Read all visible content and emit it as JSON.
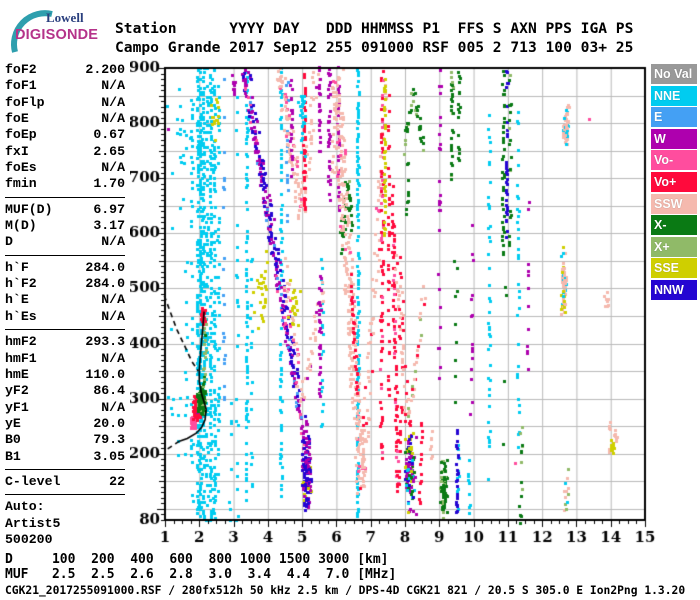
{
  "logo": {
    "top": "Lowell",
    "bottom": "DIGISONDE",
    "arc_color": "#2E9FAE"
  },
  "header": {
    "line1": "Station      YYYY DAY   DDD HHMMSS P1  FFS S AXN PPS IGA PS",
    "line2": "Campo Grande 2017 Sep12 255 091000 RSF 005 2 713 100 03+ 25"
  },
  "params": {
    "groups": [
      [
        [
          "foF2",
          "2.200"
        ],
        [
          "foF1",
          "N/A"
        ],
        [
          "foFlp",
          "N/A"
        ],
        [
          "foE",
          "N/A"
        ],
        [
          "foEp",
          "0.67"
        ],
        [
          "fxI",
          "2.65"
        ],
        [
          "foEs",
          "N/A"
        ],
        [
          "fmin",
          "1.70"
        ]
      ],
      [
        [
          "MUF(D)",
          "6.97"
        ],
        [
          "M(D)",
          "3.17"
        ],
        [
          "D",
          "N/A"
        ]
      ],
      [
        [
          "h`F",
          "284.0"
        ],
        [
          "h`F2",
          "284.0"
        ],
        [
          "h`E",
          "N/A"
        ],
        [
          "h`Es",
          "N/A"
        ]
      ],
      [
        [
          "hmF2",
          "293.3"
        ],
        [
          "hmF1",
          "N/A"
        ],
        [
          "hmE",
          "110.0"
        ],
        [
          "yF2",
          "86.4"
        ],
        [
          "yF1",
          "N/A"
        ],
        [
          "yE",
          "20.0"
        ],
        [
          "B0",
          "79.3"
        ],
        [
          "B1",
          "3.05"
        ]
      ],
      [
        [
          "C-level",
          "22"
        ]
      ]
    ],
    "auto_lines": [
      "Auto:",
      "Artist5",
      "500200"
    ]
  },
  "dmuf": {
    "d_label": "D",
    "d_values": [
      "100",
      "200",
      "400",
      "600",
      "800",
      "1000",
      "1500",
      "3000"
    ],
    "d_unit": "[km]",
    "muf_label": "MUF",
    "muf_values": [
      "2.5",
      "2.5",
      "2.6",
      "2.8",
      "3.0",
      "3.4",
      "4.4",
      "7.0"
    ],
    "muf_unit": "[MHz]"
  },
  "footer": {
    "text": "CGK21_2017255091000.RSF / 280fx512h 50 kHz 2.5 km / DPS-4D CGK21 821 / 20.5 S 305.0 E Ion2Png 1.3.20"
  },
  "chart_data": {
    "type": "scatter",
    "x_axis": {
      "label_unit": "MHz",
      "min": 1,
      "max": 15,
      "tick_labels": [
        "1",
        "2",
        "3",
        "4",
        "5",
        "6",
        "7",
        "8",
        "9",
        "10",
        "11",
        "12",
        "13",
        "14",
        "15"
      ],
      "minor_step": 0.25
    },
    "y_axis": {
      "label_unit": "km",
      "min": 80,
      "max": 900,
      "tick_labels": [
        "900",
        "800",
        "700",
        "600",
        "500",
        "400",
        "300",
        "200"
      ],
      "bottom_label": "80",
      "grid_step": 50,
      "minor_step": 10
    },
    "grid": {
      "color": "#b9b9b9",
      "frame_color": "#000000"
    },
    "legend": [
      {
        "label": "No Val",
        "color": "#999999"
      },
      {
        "label": "NNE",
        "color": "#00CCF0"
      },
      {
        "label": "E",
        "color": "#44A0F4"
      },
      {
        "label": "W",
        "color": "#AE00AE"
      },
      {
        "label": "Vo-",
        "color": "#FF4D9E"
      },
      {
        "label": "Vo+",
        "color": "#FF0A3C"
      },
      {
        "label": "SSW",
        "color": "#F5B9AE"
      },
      {
        "label": "X-",
        "color": "#0A7A14"
      },
      {
        "label": "X+",
        "color": "#90BA68"
      },
      {
        "label": "SSE",
        "color": "#CFCF00"
      },
      {
        "label": "NNW",
        "color": "#2405D2"
      }
    ],
    "profile_curve": {
      "solid": [
        [
          2.14,
          458
        ],
        [
          2.09,
          420
        ],
        [
          2.04,
          385
        ],
        [
          2.0,
          352
        ],
        [
          2.0,
          332
        ],
        [
          2.06,
          310
        ],
        [
          2.13,
          296
        ],
        [
          2.2,
          282
        ],
        [
          2.17,
          262
        ],
        [
          2.07,
          248
        ],
        [
          1.9,
          237
        ],
        [
          1.65,
          228
        ],
        [
          1.42,
          223
        ]
      ],
      "dashed": [
        [
          [
            0.98,
            487
          ],
          [
            1.15,
            458
          ],
          [
            1.35,
            425
          ],
          [
            1.58,
            395
          ],
          [
            1.78,
            368
          ],
          [
            1.97,
            350
          ]
        ],
        [
          [
            1.42,
            223
          ],
          [
            1.2,
            214
          ],
          [
            1.0,
            206
          ]
        ]
      ]
    },
    "feature_format": "v=[v,f,h0,h1,density,color] vertical RFI line; b=[b,f0,h0,f1,h1,widthMHz,density,color] echo band; o=[o,f,h,rf,rh,n,color] cluster blob; f in MHz, h in km",
    "features": [
      [
        "v",
        1.62,
        200,
        560,
        0.15,
        "NNE"
      ],
      [
        "v",
        1.78,
        90,
        870,
        0.2,
        "NNE"
      ],
      [
        "v",
        1.95,
        80,
        900,
        0.5,
        "NNE"
      ],
      [
        "v",
        2.03,
        80,
        900,
        0.65,
        "NNE"
      ],
      [
        "v",
        2.12,
        80,
        900,
        0.5,
        "NNE"
      ],
      [
        "v",
        2.22,
        80,
        900,
        0.3,
        "NNE"
      ],
      [
        "v",
        2.33,
        80,
        900,
        0.45,
        "NNE"
      ],
      [
        "v",
        2.44,
        80,
        900,
        0.4,
        "NNE"
      ],
      [
        "v",
        2.56,
        120,
        880,
        0.2,
        "NNE"
      ],
      [
        "v",
        2.72,
        300,
        880,
        0.13,
        "E"
      ],
      [
        "v",
        2.9,
        80,
        320,
        0.2,
        "NNE"
      ],
      [
        "v",
        3.1,
        80,
        860,
        0.15,
        "NNE"
      ],
      [
        "v",
        3.38,
        80,
        900,
        0.4,
        "NNE"
      ],
      [
        "v",
        3.52,
        90,
        600,
        0.13,
        "NNE"
      ],
      [
        "v",
        4.38,
        120,
        900,
        0.32,
        "NNE"
      ],
      [
        "v",
        4.56,
        550,
        900,
        0.18,
        "E"
      ],
      [
        "v",
        5.57,
        250,
        570,
        0.22,
        "NNE"
      ],
      [
        "v",
        6.62,
        80,
        900,
        0.5,
        "NNE"
      ],
      [
        "v",
        9.55,
        100,
        250,
        0.35,
        "NNE"
      ],
      [
        "v",
        9.87,
        80,
        200,
        0.28,
        "NNE"
      ],
      [
        "v",
        10.45,
        130,
        850,
        0.22,
        "NNE"
      ],
      [
        "v",
        11.3,
        200,
        830,
        0.22,
        "NNE"
      ],
      [
        "b",
        3.28,
        900,
        5.12,
        195,
        0.13,
        0.7,
        {
          "W": 0.5,
          "NNW": 0.3,
          "Vo-": 0.1,
          "E": 0.1
        }
      ],
      [
        "b",
        3.42,
        900,
        5.22,
        210,
        0.05,
        0.3,
        {
          "NNW": 0.7,
          "W": 0.3
        }
      ],
      [
        "b",
        4.34,
        900,
        4.97,
        635,
        0.26,
        0.7,
        {
          "SSW": 0.85,
          "Vo-": 0.15
        }
      ],
      [
        "b",
        4.97,
        635,
        5.42,
        900,
        0.2,
        0.5,
        {
          "SSW": 0.9,
          "W": 0.1
        }
      ],
      [
        "b",
        4.68,
        700,
        4.68,
        900,
        0.06,
        0.5,
        "W"
      ],
      [
        "b",
        5.06,
        640,
        5.06,
        900,
        0.05,
        0.55,
        "Vo+"
      ],
      [
        "b",
        5.5,
        740,
        5.5,
        900,
        0.05,
        0.5,
        "W"
      ],
      [
        "o",
        5.0,
        810,
        0.12,
        70,
        25,
        "NNE"
      ],
      [
        "b",
        4.42,
        560,
        5.0,
        288,
        0.22,
        0.55,
        {
          "SSW": 0.8,
          "Vo-": 0.2
        }
      ],
      [
        "b",
        5.0,
        288,
        5.62,
        520,
        0.18,
        0.5,
        {
          "SSW": 0.85,
          "W": 0.15
        }
      ],
      [
        "b",
        5.5,
        300,
        5.52,
        530,
        0.06,
        0.5,
        "W"
      ],
      [
        "o",
        5.12,
        165,
        0.17,
        75,
        110,
        {
          "W": 0.45,
          "NNW": 0.45,
          "SSE": 0.1
        }
      ],
      [
        "o",
        3.8,
        490,
        0.25,
        80,
        26,
        "SSE"
      ],
      [
        "o",
        4.75,
        470,
        0.2,
        70,
        20,
        "SSE"
      ],
      [
        "o",
        2.45,
        820,
        0.15,
        55,
        14,
        "SSE"
      ],
      [
        "o",
        3.0,
        870,
        0.08,
        25,
        10,
        "W"
      ],
      [
        "b",
        5.78,
        660,
        5.78,
        900,
        0.08,
        0.5,
        "W"
      ],
      [
        "b",
        6.06,
        640,
        6.06,
        900,
        0.06,
        0.45,
        {
          "W": 0.7,
          "SSW": 0.3
        }
      ],
      [
        "b",
        5.9,
        700,
        6.12,
        900,
        0.18,
        0.45,
        "SSW"
      ],
      [
        "b",
        6.1,
        560,
        6.35,
        700,
        0.2,
        0.4,
        {
          "X-": 0.8,
          "X+": 0.2
        }
      ],
      [
        "b",
        6.18,
        600,
        6.32,
        695,
        0.07,
        0.5,
        "X-"
      ],
      [
        "b",
        6.32,
        695,
        6.48,
        590,
        0.07,
        0.45,
        "X-"
      ],
      [
        "b",
        5.98,
        880,
        6.73,
        135,
        0.28,
        0.75,
        {
          "SSW": 0.92,
          "Vo-": 0.08
        }
      ],
      [
        "b",
        6.73,
        135,
        7.2,
        620,
        0.2,
        0.5,
        {
          "SSW": 0.85,
          "Vo+": 0.15
        }
      ],
      [
        "b",
        7.2,
        620,
        7.42,
        880,
        0.15,
        0.4,
        {
          "SSW": 0.8,
          "Vo-": 0.2
        }
      ],
      [
        "b",
        6.35,
        560,
        6.62,
        300,
        0.07,
        0.45,
        "Vo+"
      ],
      [
        "b",
        7.62,
        680,
        7.78,
        135,
        0.08,
        0.55,
        {
          "Vo+": 0.8,
          "Vo-": 0.2
        }
      ],
      [
        "b",
        7.78,
        135,
        7.92,
        300,
        0.06,
        0.4,
        "Vo+"
      ],
      [
        "b",
        7.3,
        200,
        7.34,
        900,
        0.07,
        0.5,
        {
          "Vo+": 0.75,
          "Vo-": 0.25
        }
      ],
      [
        "b",
        7.4,
        600,
        7.4,
        880,
        0.05,
        0.5,
        "SSE"
      ],
      [
        "b",
        7.52,
        300,
        7.52,
        870,
        0.05,
        0.22,
        "Vo+"
      ],
      [
        "b",
        7.75,
        560,
        8.1,
        245,
        0.18,
        0.5,
        {
          "SSW": 0.6,
          "Vo+": 0.4
        }
      ],
      [
        "b",
        8.1,
        245,
        8.6,
        520,
        0.15,
        0.42,
        {
          "SSW": 0.55,
          "Vo+": 0.3,
          "X+": 0.15
        }
      ],
      [
        "b",
        7.95,
        750,
        8.25,
        862,
        0.1,
        0.5,
        {
          "X-": 0.8,
          "X+": 0.2
        }
      ],
      [
        "b",
        8.25,
        862,
        8.55,
        748,
        0.1,
        0.42,
        {
          "X-": 0.8,
          "X+": 0.2
        }
      ],
      [
        "b",
        8.05,
        620,
        8.08,
        740,
        0.08,
        0.35,
        "X-"
      ],
      [
        "o",
        8.15,
        170,
        0.18,
        85,
        120,
        {
          "W": 0.3,
          "SSE": 0.25,
          "NNW": 0.2,
          "X-": 0.15,
          "NNE": 0.1
        }
      ],
      [
        "b",
        8.44,
        100,
        8.47,
        262,
        0.06,
        0.5,
        "Vo+"
      ],
      [
        "b",
        8.75,
        180,
        8.78,
        262,
        0.06,
        0.3,
        "SSW"
      ],
      [
        "b",
        9.0,
        580,
        9.02,
        900,
        0.06,
        0.2,
        "W"
      ],
      [
        "b",
        9.0,
        300,
        9.0,
        560,
        0.05,
        0.1,
        "W"
      ],
      [
        "b",
        9.35,
        700,
        9.37,
        900,
        0.07,
        0.5,
        {
          "X-": 0.8,
          "X+": 0.2
        }
      ],
      [
        "b",
        9.56,
        730,
        9.58,
        900,
        0.06,
        0.4,
        "X-"
      ],
      [
        "b",
        9.45,
        300,
        9.5,
        650,
        0.1,
        0.07,
        "X-"
      ],
      [
        "o",
        9.12,
        135,
        0.13,
        60,
        70,
        {
          "X-": 0.7,
          "X+": 0.3
        }
      ],
      [
        "b",
        9.5,
        90,
        9.52,
        250,
        0.05,
        0.45,
        "NNW"
      ],
      [
        "b",
        9.93,
        260,
        9.96,
        620,
        0.06,
        0.15,
        "W"
      ],
      [
        "b",
        10.85,
        560,
        10.87,
        900,
        0.06,
        0.5,
        "X-"
      ],
      [
        "b",
        10.95,
        600,
        10.97,
        900,
        0.05,
        0.5,
        "NNW"
      ],
      [
        "b",
        11.05,
        560,
        11.07,
        900,
        0.06,
        0.32,
        {
          "X-": 0.7,
          "X+": 0.3
        }
      ],
      [
        "b",
        10.8,
        200,
        10.9,
        540,
        0.12,
        0.06,
        "X-"
      ],
      [
        "b",
        11.36,
        80,
        11.4,
        260,
        0.09,
        0.28,
        {
          "X-": 0.75,
          "X+": 0.25
        }
      ],
      [
        "b",
        11.57,
        300,
        11.6,
        680,
        0.05,
        0.13,
        "W"
      ],
      [
        "o",
        12.7,
        795,
        0.12,
        40,
        55,
        {
          "SSW": 0.8,
          "NNE": 0.2
        }
      ],
      [
        "o",
        12.62,
        510,
        0.1,
        80,
        60,
        {
          "SSW": 0.55,
          "SSE": 0.25,
          "NNE": 0.2
        }
      ],
      [
        "o",
        12.7,
        140,
        0.15,
        60,
        12,
        {
          "SSW": 0.5,
          "X+": 0.3,
          "NNE": 0.2
        }
      ],
      [
        "b",
        13.95,
        205,
        13.98,
        258,
        0.05,
        0.55,
        "SSW"
      ],
      [
        "o",
        14.05,
        215,
        0.08,
        18,
        12,
        "SSE"
      ],
      [
        "o",
        14.15,
        235,
        0.06,
        20,
        8,
        "SSW"
      ],
      [
        "o",
        13.88,
        480,
        0.08,
        25,
        8,
        "SSW"
      ],
      [
        "o",
        11.2,
        185,
        0.01,
        3,
        1,
        "Vo-"
      ],
      [
        "o",
        13.35,
        808,
        0.01,
        3,
        1,
        "Vo-"
      ],
      [
        "o",
        1.08,
        790,
        0.01,
        3,
        1,
        "W"
      ],
      [
        "o",
        1.82,
        258,
        0.09,
        14,
        40,
        "Vo-"
      ],
      [
        "o",
        1.92,
        283,
        0.13,
        24,
        110,
        {
          "Vo+": 0.95,
          "W": 0.05
        }
      ],
      [
        "o",
        2.06,
        295,
        0.13,
        28,
        120,
        {
          "X-": 0.85,
          "X+": 0.15
        }
      ],
      [
        "b",
        2.14,
        322,
        2.18,
        462,
        0.08,
        0.42,
        {
          "X+": 0.8,
          "X-": 0.2
        }
      ],
      [
        "o",
        2.1,
        450,
        0.07,
        16,
        28,
        "Vo+"
      ],
      [
        "o",
        1.45,
        740,
        0.45,
        160,
        22,
        "NNE"
      ],
      [
        "o",
        1.3,
        320,
        0.3,
        150,
        10,
        "NNE"
      ]
    ]
  }
}
